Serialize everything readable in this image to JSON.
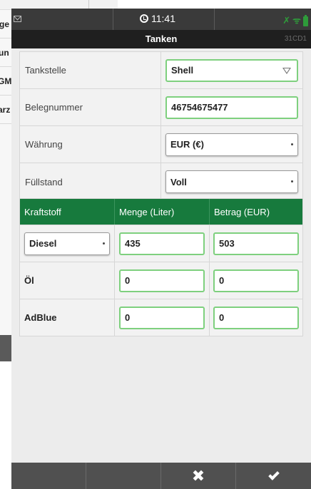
{
  "background_app": {
    "items": [
      "ge",
      "un",
      "GM",
      "arz"
    ]
  },
  "statusbar": {
    "time": "11:41"
  },
  "titlebar": {
    "title": "Tanken",
    "code": "31CD1"
  },
  "form": {
    "tankstelle": {
      "label": "Tankstelle",
      "value": "Shell"
    },
    "belegnummer": {
      "label": "Belegnummer",
      "value": "46754675477"
    },
    "waehrung": {
      "label": "Währung",
      "value": "EUR (€)"
    },
    "fuellstand": {
      "label": "Füllstand",
      "value": "Voll"
    }
  },
  "fuel_table": {
    "headers": [
      "Kraftstoff",
      "Menge (Liter)",
      "Betrag (EUR)"
    ],
    "rows": [
      {
        "kraftstoff": "Diesel",
        "menge": "435",
        "betrag": "503"
      },
      {
        "kraftstoff": "Öl",
        "menge": "0",
        "betrag": "0"
      },
      {
        "kraftstoff": "AdBlue",
        "menge": "0",
        "betrag": "0"
      }
    ]
  },
  "footer": {
    "cancel_symbol": "✖"
  },
  "colors": {
    "header_green": "#177a3d",
    "field_border_green": "#7ed07e",
    "signal_green": "#2e9b3a",
    "statusbar": "#3a3a3a",
    "titlebar": "#1f1f1f",
    "footer": "#505050"
  }
}
